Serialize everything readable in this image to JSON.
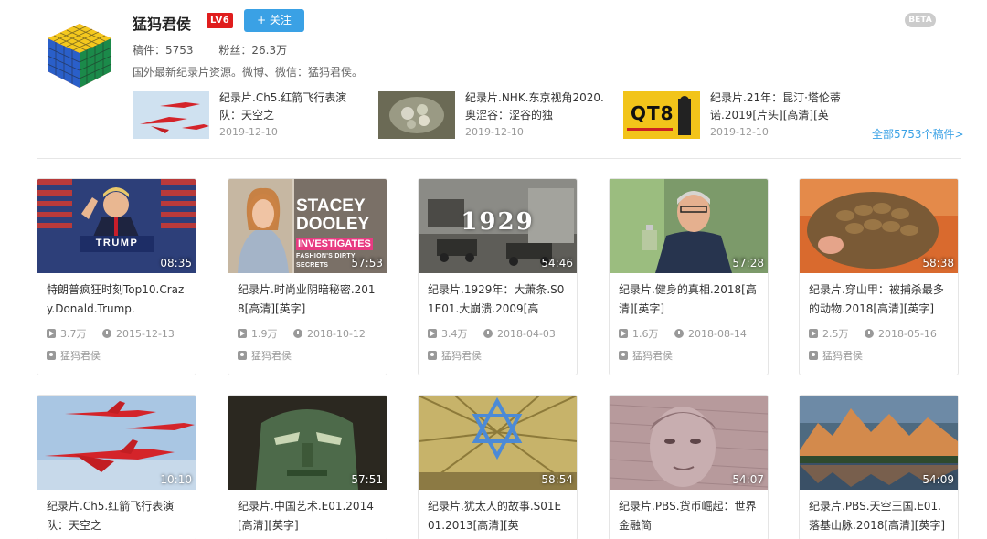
{
  "uploader": {
    "name": "猛犸君侯",
    "level": "LV6",
    "follow_label": "+ 关注",
    "stats_videos": "稿件：5753",
    "stats_fans": "粉丝：26.3万",
    "description": "国外最新纪录片资源。微博、微信：猛犸君侯。",
    "beta": "BETA"
  },
  "recent": [
    {
      "title": "纪录片.Ch5.红箭飞行表演队：天空之",
      "date": "2019-12-10"
    },
    {
      "title": "纪录片.NHK.东京视角2020.奥涩谷：涩谷的独",
      "date": "2019-12-10"
    },
    {
      "title": "纪录片.21年：昆汀·塔伦蒂诺.2019[片头][高清][英",
      "date": "2019-12-10"
    }
  ],
  "recent_thumb_text": {
    "qt8": "QT8"
  },
  "all_link": "全部5753个稿件>",
  "cards_row1": [
    {
      "title": "特朗普疯狂时刻Top10.Crazy.Donald.Trump.",
      "duration": "08:35",
      "views": "3.7万",
      "date": "2015-12-13",
      "author": "猛犸君侯",
      "thumb_text": "TRUMP"
    },
    {
      "title": "纪录片.时尚业阴暗秘密.2018[高清][英字]",
      "duration": "57:53",
      "views": "1.9万",
      "date": "2018-10-12",
      "author": "猛犸君侯",
      "thumb_text": "STACEY|DOOLEY|INVESTIGATES|FASHION'S DIRTY SECRETS"
    },
    {
      "title": "纪录片.1929年：大萧条.S01E01.大崩溃.2009[高",
      "duration": "54:46",
      "views": "3.4万",
      "date": "2018-04-03",
      "author": "猛犸君侯",
      "thumb_text": "1929"
    },
    {
      "title": "纪录片.健身的真相.2018[高清][英字]",
      "duration": "57:28",
      "views": "1.6万",
      "date": "2018-08-14",
      "author": "猛犸君侯",
      "thumb_text": ""
    },
    {
      "title": "纪录片.穿山甲：被捕杀最多的动物.2018[高清][英字]",
      "duration": "58:38",
      "views": "2.5万",
      "date": "2018-05-16",
      "author": "猛犸君侯",
      "thumb_text": ""
    }
  ],
  "cards_row2": [
    {
      "title": "纪录片.Ch5.红箭飞行表演队：天空之",
      "duration": "10:10"
    },
    {
      "title": "纪录片.中国艺术.E01.2014[高清][英字]",
      "duration": "57:51"
    },
    {
      "title": "纪录片.犹太人的故事.S01E01.2013[高清][英",
      "duration": "58:54"
    },
    {
      "title": "纪录片.PBS.货币崛起：世界金融简",
      "duration": "54:07"
    },
    {
      "title": "纪录片.PBS.天空王国.E01.落基山脉.2018[高清][英字]",
      "duration": "54:09"
    }
  ],
  "colors": {
    "accent": "#3aa1e5",
    "level_badge": "#e01d1d"
  }
}
